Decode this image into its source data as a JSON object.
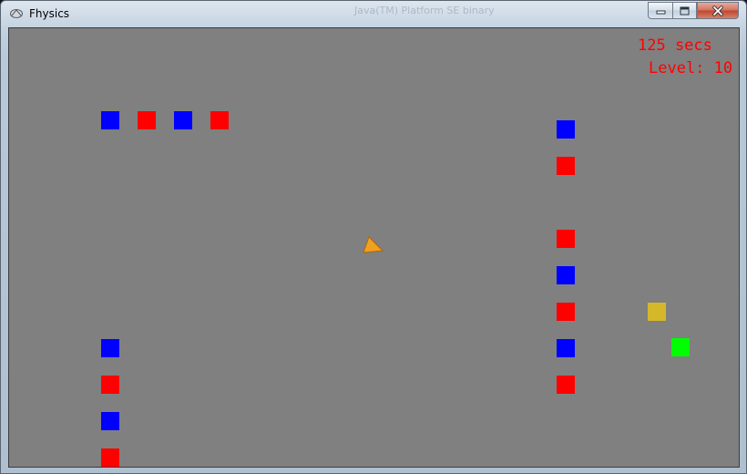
{
  "window": {
    "title": "Fhysics",
    "background_title": "Java(TM) Platform SE binary",
    "icon": "app-icon",
    "buttons": [
      "minimize-icon",
      "maximize-icon",
      "close-icon"
    ]
  },
  "hud": {
    "time": "125 secs",
    "level": "Level: 10",
    "color": "#ff0000"
  },
  "colors": {
    "background": "#808080",
    "blue": "#0000ff",
    "red": "#ff0000",
    "gold": "#d4b82a",
    "green": "#00ff00",
    "ship": "#f0a020"
  },
  "ship": {
    "icon": "triangle-ship-icon"
  },
  "blocks": [
    {
      "color": "blue"
    },
    {
      "color": "red"
    },
    {
      "color": "blue"
    },
    {
      "color": "red"
    },
    {
      "color": "blue"
    },
    {
      "color": "red"
    },
    {
      "color": "blue"
    },
    {
      "color": "red"
    },
    {
      "color": "blue"
    },
    {
      "color": "red"
    },
    {
      "color": "blue"
    },
    {
      "color": "red"
    },
    {
      "color": "blue"
    },
    {
      "color": "red"
    },
    {
      "color": "gold"
    },
    {
      "color": "green"
    }
  ]
}
